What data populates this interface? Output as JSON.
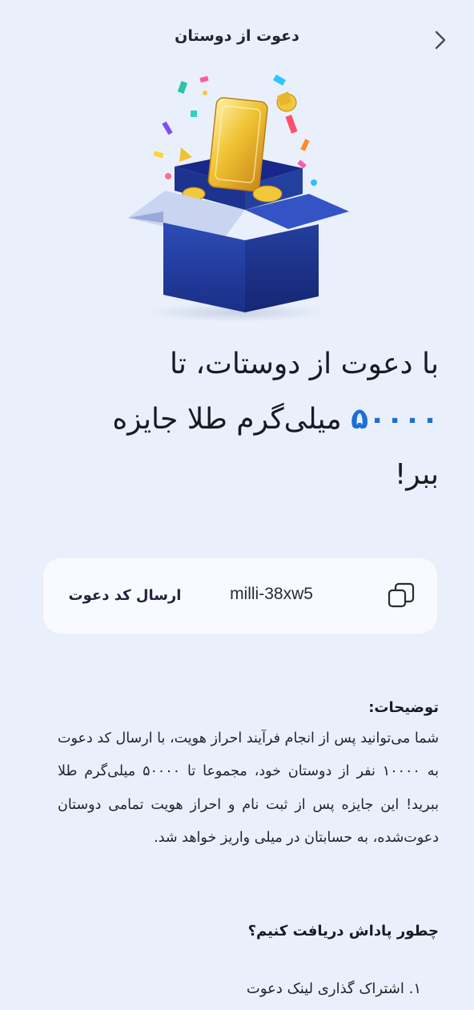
{
  "header": {
    "title": "دعوت از دوستان",
    "back_icon": "chevron-right-icon"
  },
  "hero": {
    "image": "gift-box-with-gold-bar-illustration"
  },
  "headline": {
    "line_prefix": "با دعوت از دوستات، تا",
    "amount": "۵۰۰۰۰",
    "line_suffix": "میلی‌گرم طلا جایزه ببر!"
  },
  "invite": {
    "code": "milli-38xw5",
    "send_label": "ارسال کد دعوت",
    "copy_icon": "copy-icon"
  },
  "description": {
    "title": "توضیحات:",
    "body": "شما می‌توانید پس از انجام فرآیند احراز هویت، با ارسال کد دعوت به ۱۰۰۰۰ نفر از دوستان خود، مجموعا تا ۵۰۰۰۰ میلی‌گرم طلا ببرید! این جایزه پس از ثبت نام و احراز هویت تمامی دوستان دعوت‌شده، به حسابتان در میلی واریز خواهد شد."
  },
  "how": {
    "title": "چطور پاداش دریافت کنیم؟",
    "steps": [
      "۱. اشتراک گذاری لینک دعوت"
    ]
  },
  "colors": {
    "background": "#eaf0fb",
    "card": "#f8faff",
    "accent": "#1e6ed4",
    "box_blue": "#1f3c97",
    "gold": "#e8b62c"
  }
}
